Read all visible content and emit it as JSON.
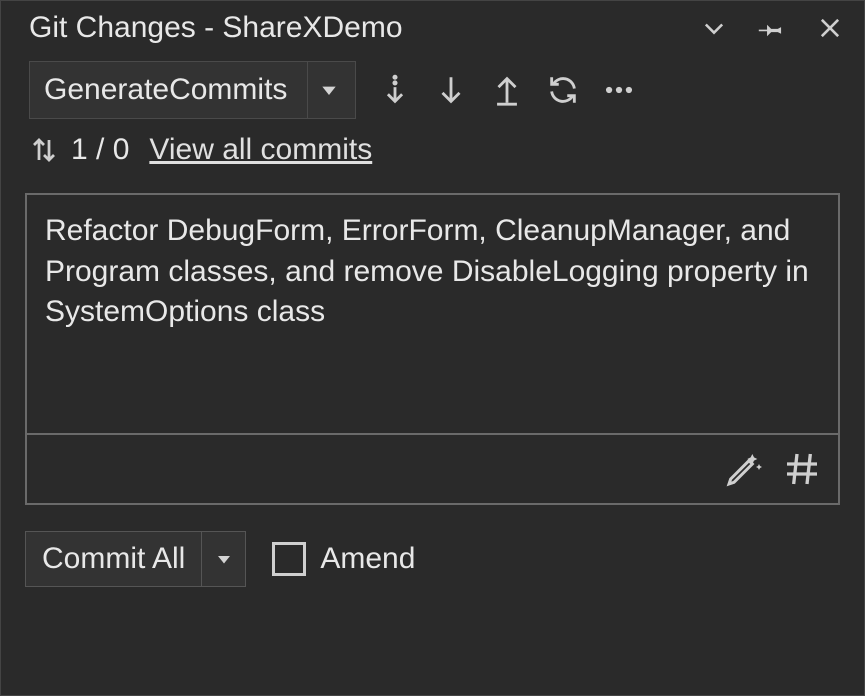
{
  "titlebar": {
    "title": "Git Changes - ShareXDemo"
  },
  "branch": {
    "name": "GenerateCommits"
  },
  "sync": {
    "status": "1 / 0",
    "view_all_link": "View all commits"
  },
  "commit": {
    "message": "Refactor DebugForm, ErrorForm, CleanupManager, and Program classes, and remove DisableLogging property in SystemOptions class",
    "button_label": "Commit All",
    "amend_label": "Amend",
    "amend_checked": false
  },
  "icons": {
    "chevron_down": "chevron-down",
    "pin": "pin",
    "close": "close",
    "fetch": "fetch",
    "pull": "pull",
    "push": "push",
    "sync": "sync",
    "more": "more",
    "updown_arrows": "updown",
    "ai_pen": "ai-pen",
    "hash": "hash",
    "caret": "caret"
  }
}
